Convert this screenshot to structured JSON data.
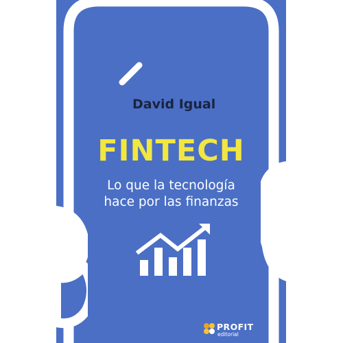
{
  "book": {
    "author": "David Igual",
    "title": "FINTECH",
    "subtitle_line1": "Lo que la tecnología",
    "subtitle_line2": "hace por las finanzas",
    "publisher_name": "PROFIT",
    "publisher_sub": "editorial"
  },
  "colors": {
    "cover_blue": "#4a6fc4",
    "title_yellow": "#f2e640",
    "author_dark": "#1a2340",
    "outline_white": "#ffffff",
    "brand_orange": "#f0a020"
  },
  "icons": {
    "chart": "rising-bar-chart-icon",
    "publisher": "profit-logo-icon"
  }
}
